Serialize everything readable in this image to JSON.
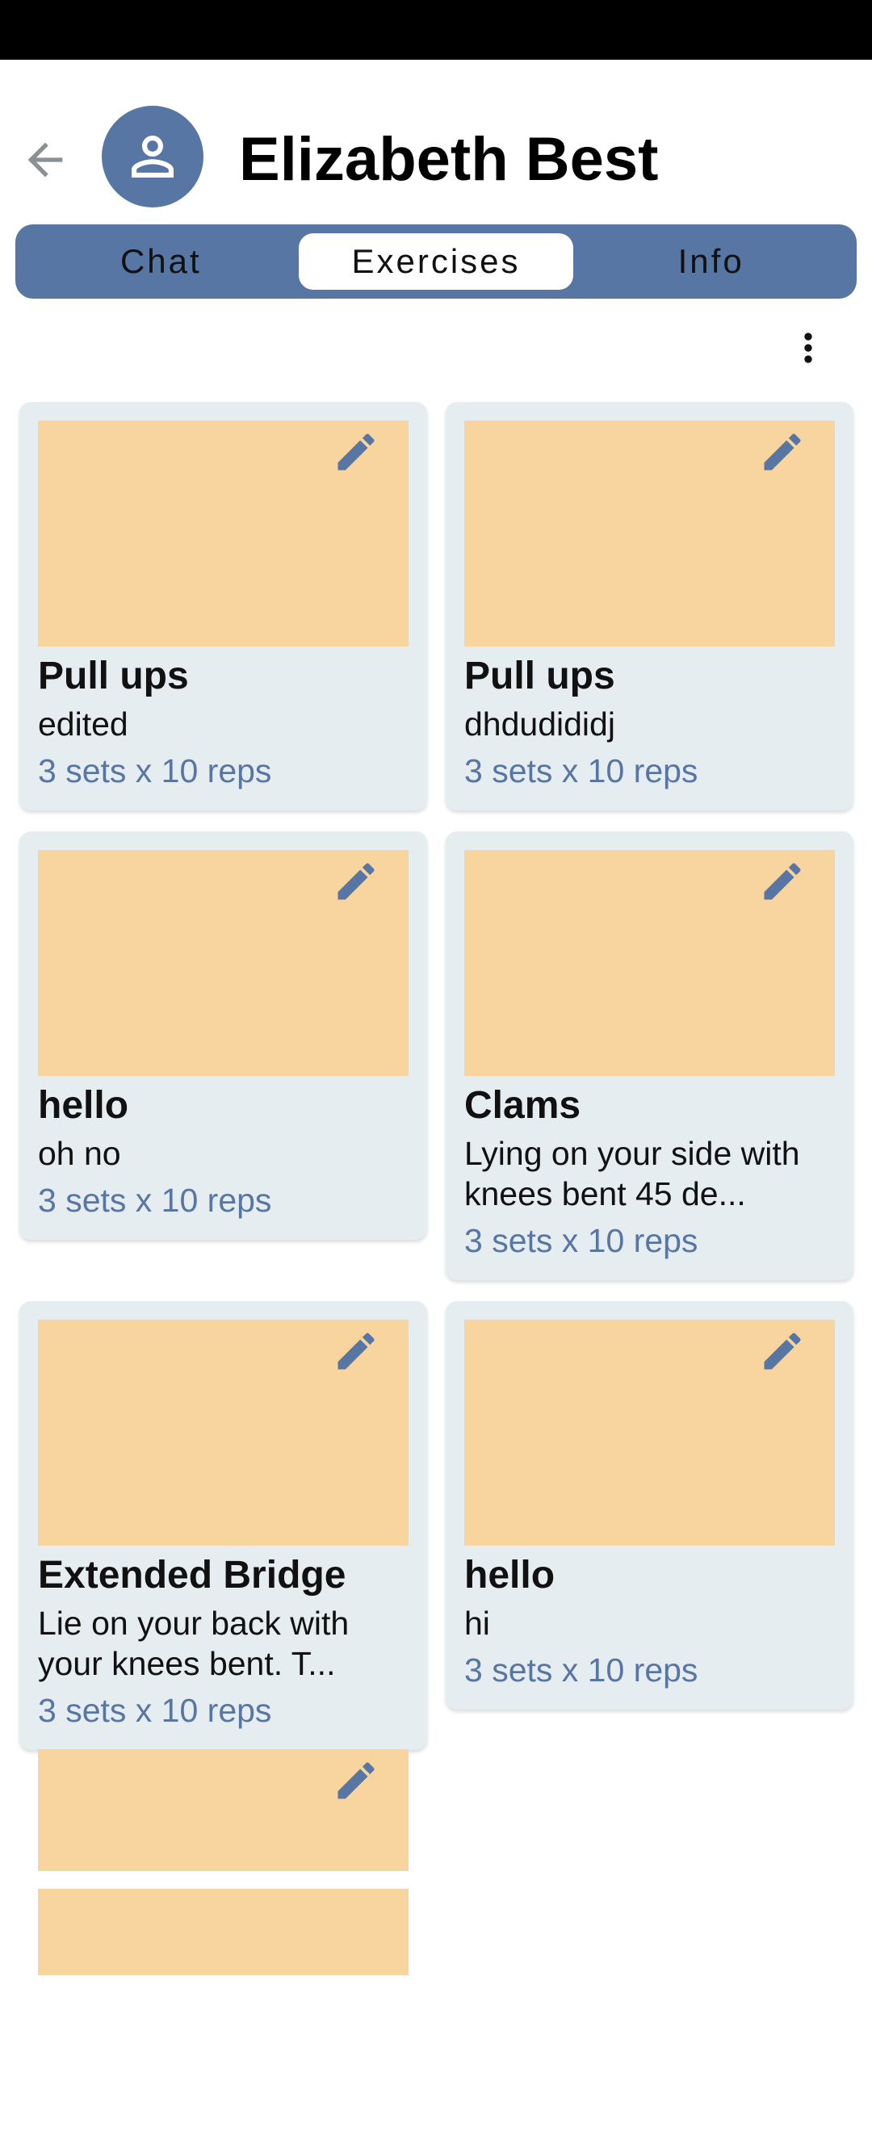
{
  "colors": {
    "accent": "#5776a3",
    "image_placeholder": "#f8d49e",
    "card_bg": "#e6edf0"
  },
  "header": {
    "back_icon": "arrow-back-icon",
    "avatar_icon": "person-icon",
    "contact_name": "Elizabeth Best"
  },
  "tabs": [
    {
      "label": "Chat",
      "active": false
    },
    {
      "label": "Exercises",
      "active": true
    },
    {
      "label": "Info",
      "active": false
    }
  ],
  "toolbar": {
    "more_icon": "more-vert-icon"
  },
  "exercises": [
    {
      "title": "Pull ups",
      "description": "edited",
      "sets": "3 sets x 10 reps"
    },
    {
      "title": "Pull ups",
      "description": "dhdudididj",
      "sets": "3 sets x 10 reps"
    },
    {
      "title": "hello",
      "description": "oh no",
      "sets": "3 sets x 10 reps"
    },
    {
      "title": "Clams",
      "description": "Lying on your side with knees bent 45 de...",
      "sets": "3 sets x 10 reps"
    },
    {
      "title": "Extended Bridge",
      "description": "Lie on your back with your knees bent. T...",
      "sets": "3 sets x 10 reps"
    },
    {
      "title": "hello",
      "description": "hi",
      "sets": "3 sets x 10 reps"
    },
    {
      "title": "",
      "description": "",
      "sets": ""
    }
  ]
}
